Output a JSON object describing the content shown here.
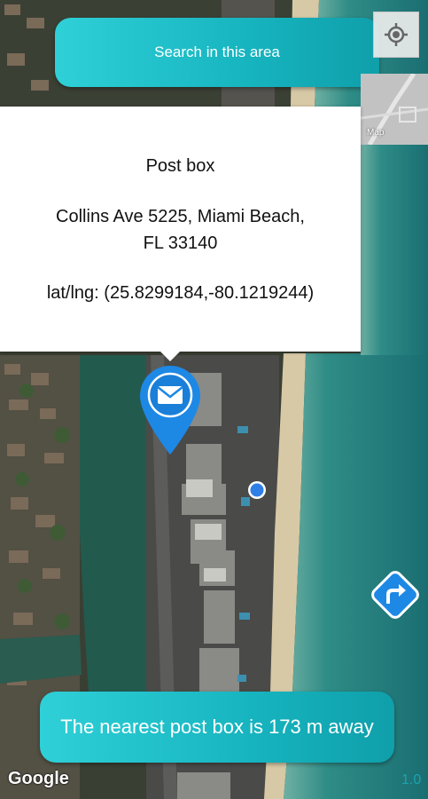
{
  "search_area_button": "Search in this area",
  "maptype_button": "Map",
  "info_window": {
    "title": "Post box",
    "address_line1": "Collins Ave 5225,  Miami Beach,",
    "address_line2": "FL 33140",
    "latlng": "lat/lng: (25.8299184,-80.1219244)"
  },
  "nearest_message": "The nearest post box is 173 m away",
  "google_logo": "Google",
  "version": "1.0",
  "colors": {
    "accent": "#17b6c1",
    "marker": "#1e88e5",
    "directions": "#1e88e5"
  },
  "icons": [
    "my-location-icon",
    "mail-icon",
    "directions-icon",
    "user-location-icon"
  ]
}
